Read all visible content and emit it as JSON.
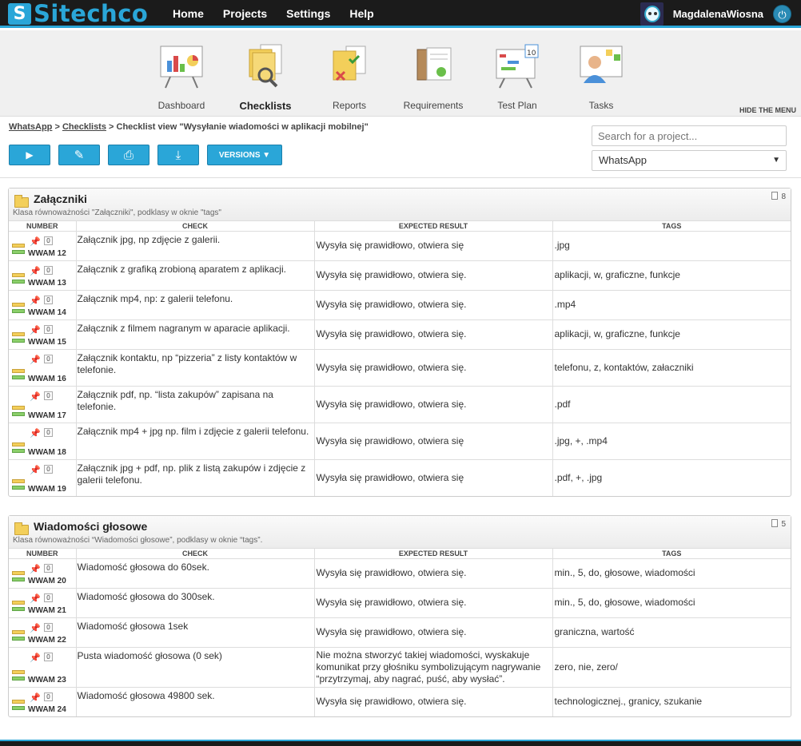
{
  "brand": {
    "logo_letter": "S",
    "name": "Sitechco"
  },
  "nav": [
    "Home",
    "Projects",
    "Settings",
    "Help"
  ],
  "user": {
    "name": "MagdalenaWiosna",
    "logout_icon": "power-icon"
  },
  "iconbar": {
    "items": [
      {
        "label": "Dashboard",
        "icon": "dashboard-icon"
      },
      {
        "label": "Checklists",
        "icon": "checklists-icon",
        "active": true
      },
      {
        "label": "Reports",
        "icon": "reports-icon"
      },
      {
        "label": "Requirements",
        "icon": "requirements-icon"
      },
      {
        "label": "Test Plan",
        "icon": "test-plan-icon"
      },
      {
        "label": "Tasks",
        "icon": "tasks-icon"
      }
    ],
    "hide_menu": "HIDE THE MENU"
  },
  "breadcrumb": {
    "project": "WhatsApp",
    "sep1": " > ",
    "checklists": "Checklists",
    "rest": " > Checklist view \"Wysyłanie wiadomości w aplikacji mobilnej\""
  },
  "toolbar": {
    "play": "▶",
    "edit": "✎",
    "print": "⎙",
    "download": "⤓",
    "versions": "VERSIONS ▼"
  },
  "search": {
    "placeholder": "Search for a project..."
  },
  "project_select": {
    "value": "WhatsApp"
  },
  "columns": {
    "number": "NUMBER",
    "check": "CHECK",
    "expected": "EXPECTED RESULT",
    "tags": "TAGS"
  },
  "sections": [
    {
      "title": "Załączniki",
      "subtitle": "Klasa równoważności \"Załączniki\", podklasy w oknie \"tags\"",
      "count": "8",
      "rows": [
        {
          "pins": "0",
          "id": "WWAM 12",
          "check": "Załącznik jpg, np zdjęcie z galerii.",
          "expected": "Wysyła się prawidłowo, otwiera się",
          "tags": ".jpg"
        },
        {
          "pins": "0",
          "id": "WWAM 13",
          "check": "Załącznik z grafiką zrobioną aparatem z aplikacji.",
          "expected": "Wysyła się prawidłowo, otwiera się.",
          "tags": "aplikacji, w, graficzne, funkcje"
        },
        {
          "pins": "0",
          "id": "WWAM 14",
          "check": "Załącznik mp4, np: z galerii telefonu.",
          "expected": "Wysyła się prawidłowo, otwiera się.",
          "tags": ".mp4"
        },
        {
          "pins": "0",
          "id": "WWAM 15",
          "check": "Załącznik z filmem nagranym w aparacie aplikacji.",
          "expected": "Wysyła się prawidłowo, otwiera się.",
          "tags": "aplikacji, w, graficzne, funkcje"
        },
        {
          "pins": "0",
          "id": "WWAM 16",
          "check": "Załącznik kontaktu, np “pizzeria” z listy kontaktów w telefonie.",
          "expected": "Wysyła się prawidłowo, otwiera się.",
          "tags": "telefonu, z, kontaktów, załaczniki"
        },
        {
          "pins": "0",
          "id": "WWAM 17",
          "check": "Załącznik pdf, np. “lista zakupów” zapisana na telefonie.",
          "expected": "Wysyła się prawidłowo, otwiera się.",
          "tags": ".pdf"
        },
        {
          "pins": "0",
          "id": "WWAM 18",
          "check": "Załącznik mp4 + jpg np. film i zdjęcie z galerii telefonu.",
          "expected": "Wysyła się prawidłowo, otwiera się",
          "tags": ".jpg, +, .mp4"
        },
        {
          "pins": "0",
          "id": "WWAM 19",
          "check": "Załącznik jpg + pdf, np. plik z listą zakupów i zdjęcie z galerii telefonu.",
          "expected": "Wysyła się prawidłowo, otwiera się",
          "tags": ".pdf, +, .jpg"
        }
      ]
    },
    {
      "title": "Wiadomości głosowe",
      "subtitle": "Klasa równoważności “Wiadomości głosowe”, podklasy w oknie “tags”.",
      "count": "5",
      "rows": [
        {
          "pins": "0",
          "id": "WWAM 20",
          "check": "Wiadomość głosowa do 60sek.",
          "expected": "Wysyła się prawidłowo, otwiera się.",
          "tags": "min., 5, do, głosowe, wiadomości"
        },
        {
          "pins": "0",
          "id": "WWAM 21",
          "check": "Wiadomość głosowa do 300sek.",
          "expected": "Wysyła się prawidłowo, otwiera się.",
          "tags": "min., 5, do, głosowe, wiadomości"
        },
        {
          "pins": "0",
          "id": "WWAM 22",
          "check": "Wiadomość głosowa 1sek",
          "expected": "Wysyła się prawidłowo, otwiera się.",
          "tags": "graniczna, wartość"
        },
        {
          "pins": "0",
          "id": "WWAM 23",
          "check": "Pusta wiadomość głosowa (0 sek)",
          "expected": "Nie można stworzyć takiej wiadomości, wyskakuje komunikat przy głośniku symbolizującym nagrywanie “przytrzymaj, aby nagrać, puść, aby wysłać”.",
          "tags": "zero, nie, zero/"
        },
        {
          "pins": "0",
          "id": "WWAM 24",
          "check": "Wiadomość głosowa 49800 sek.",
          "expected": "Wysyła się prawidłowo, otwiera się.",
          "tags": "technologicznej., granicy, szukanie"
        }
      ]
    }
  ],
  "colors": {
    "accent": "#2aa6d8",
    "topbar": "#1b1b1b",
    "status_yellow": "#f3cf5a",
    "status_green": "#8bcf6a"
  }
}
